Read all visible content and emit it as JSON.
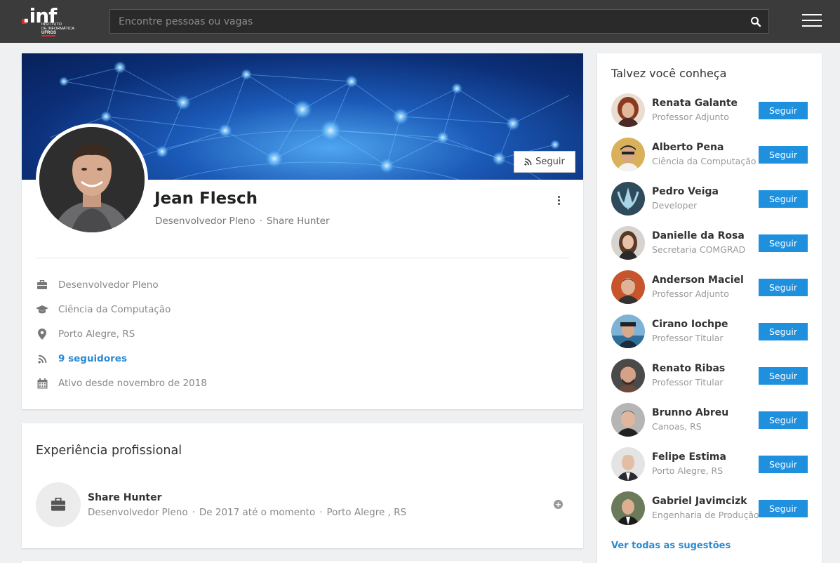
{
  "header": {
    "logo_text": ".inf",
    "logo_line1": "Instituto",
    "logo_line2": "de Informática",
    "logo_line3": "UFRGS",
    "search_placeholder": "Encontre pessoas ou vagas",
    "search_icon": "search-icon",
    "menu_icon": "hamburger-icon"
  },
  "profile": {
    "follow_label": "Seguir",
    "name": "Jean Flesch",
    "role": "Desenvolvedor Pleno",
    "company": "Share Hunter",
    "separator": "·",
    "info": [
      {
        "icon": "briefcase-icon",
        "text": "Desenvolvedor Pleno"
      },
      {
        "icon": "graduation-cap-icon",
        "text": "Ciência da Computação"
      },
      {
        "icon": "map-marker-icon",
        "text": "Porto Alegre, RS"
      },
      {
        "icon": "rss-icon",
        "text": "9 seguidores"
      },
      {
        "icon": "calendar-icon",
        "text": "Ativo desde novembro de 2018"
      }
    ]
  },
  "experience": {
    "title": "Experiência profissional",
    "items": [
      {
        "company": "Share Hunter",
        "role": "Desenvolvedor Pleno",
        "period": "De 2017 até o momento",
        "location": "Porto Alegre , RS"
      }
    ]
  },
  "suggestions": {
    "title": "Talvez você conheça",
    "button_label": "Seguir",
    "see_all": "Ver todas as sugestões",
    "colors": {
      "button": "#1f90de",
      "link": "#2b8ad1"
    },
    "people": [
      {
        "name": "Renata Galante",
        "subtitle": "Professor Adjunto"
      },
      {
        "name": "Alberto Pena",
        "subtitle": "Ciência da Computação"
      },
      {
        "name": "Pedro Veiga",
        "subtitle": "Developer"
      },
      {
        "name": "Danielle da Rosa",
        "subtitle": "Secretaria COMGRAD"
      },
      {
        "name": "Anderson Maciel",
        "subtitle": "Professor Adjunto"
      },
      {
        "name": "Cirano Iochpe",
        "subtitle": "Professor Titular"
      },
      {
        "name": "Renato Ribas",
        "subtitle": "Professor Titular"
      },
      {
        "name": "Brunno Abreu",
        "subtitle": "Canoas, RS"
      },
      {
        "name": "Felipe Estima",
        "subtitle": "Porto Alegre, RS"
      },
      {
        "name": "Gabriel Javimcizk",
        "subtitle": "Engenharia de Produção"
      }
    ]
  }
}
